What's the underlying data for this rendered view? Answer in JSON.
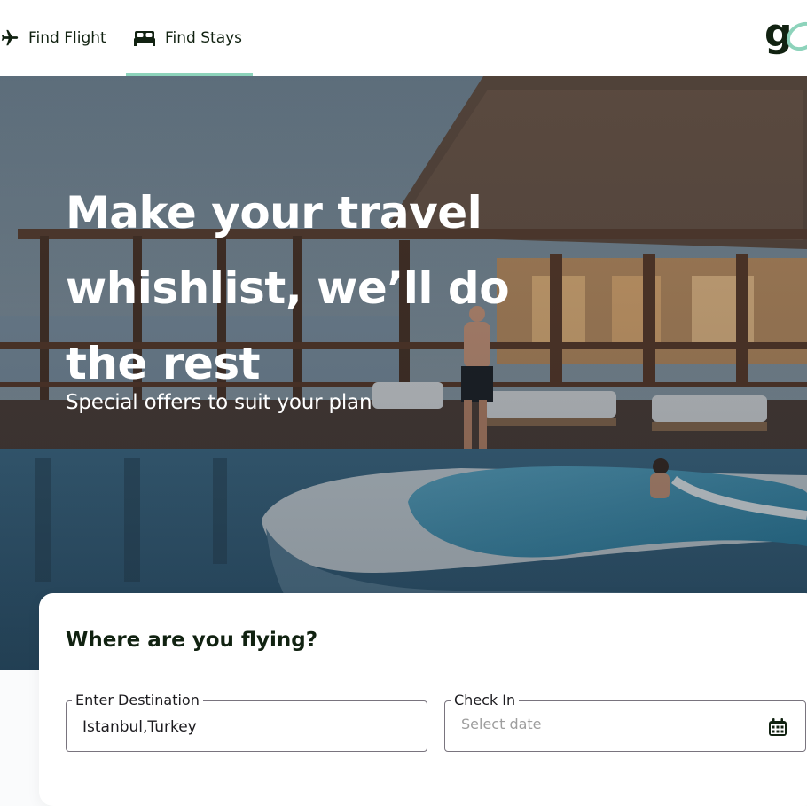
{
  "nav": {
    "flight_label": "Find Flight",
    "stays_label": "Find Stays",
    "logo_text": "g"
  },
  "hero": {
    "title": "Make your travel whishlist, we’ll do the rest",
    "subtitle": "Special offers to suit your plan"
  },
  "search": {
    "title": "Where are you flying?",
    "destination": {
      "label": "Enter Destination",
      "value": "Istanbul,Turkey"
    },
    "check_in": {
      "label": "Check In",
      "placeholder": "Select date"
    }
  },
  "icons": {
    "flight": "airplane-icon",
    "stays": "bed-icon",
    "calendar": "calendar-icon"
  },
  "colors": {
    "accent": "#8dd3bb",
    "text_dark": "#112211",
    "field_border": "#79747e"
  }
}
